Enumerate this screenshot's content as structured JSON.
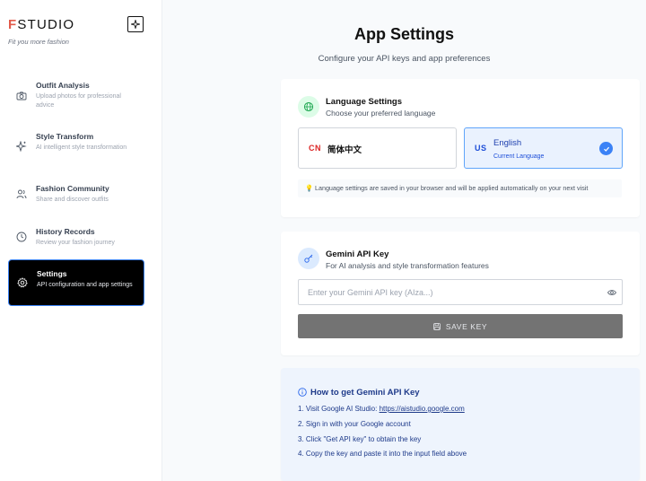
{
  "brand": {
    "initial": "F",
    "rest": "STUDIO",
    "tagline": "Fit you more fashion"
  },
  "nav": [
    {
      "title": "Outfit Analysis",
      "desc": "Upload photos for professional advice"
    },
    {
      "title": "Style Transform",
      "desc": "AI intelligent style transformation"
    },
    {
      "title": "Fashion Community",
      "desc": "Share and discover outfits"
    },
    {
      "title": "History Records",
      "desc": "Review your fashion journey"
    },
    {
      "title": "Settings",
      "desc": "API configuration and app settings"
    }
  ],
  "page": {
    "title": "App Settings",
    "subtitle": "Configure your API keys and app preferences"
  },
  "language": {
    "title": "Language Settings",
    "desc": "Choose your preferred language",
    "options": [
      {
        "flag": "CN",
        "label": "简体中文"
      },
      {
        "flag": "US",
        "label": "English",
        "sub": "Current Language"
      }
    ],
    "note": "💡 Language settings are saved in your browser and will be applied automatically on your next visit"
  },
  "api": {
    "title": "Gemini API Key",
    "desc": "For AI analysis and style transformation features",
    "placeholder": "Enter your Gemini API key (AIza...)",
    "value": "",
    "save_label": "SAVE KEY"
  },
  "help": {
    "title": "How to get Gemini API Key",
    "step1_prefix": "1. Visit Google AI Studio: ",
    "step1_link": "https://aistudio.google.com",
    "step2": "2. Sign in with your Google account",
    "step3": "3. Click \"Get API key\" to obtain the key",
    "step4": "4. Copy the key and paste it into the input field above"
  },
  "colors": {
    "accent": "#3b82f6",
    "brand_red": "#e25a4a",
    "active_nav_bg": "#000000"
  }
}
